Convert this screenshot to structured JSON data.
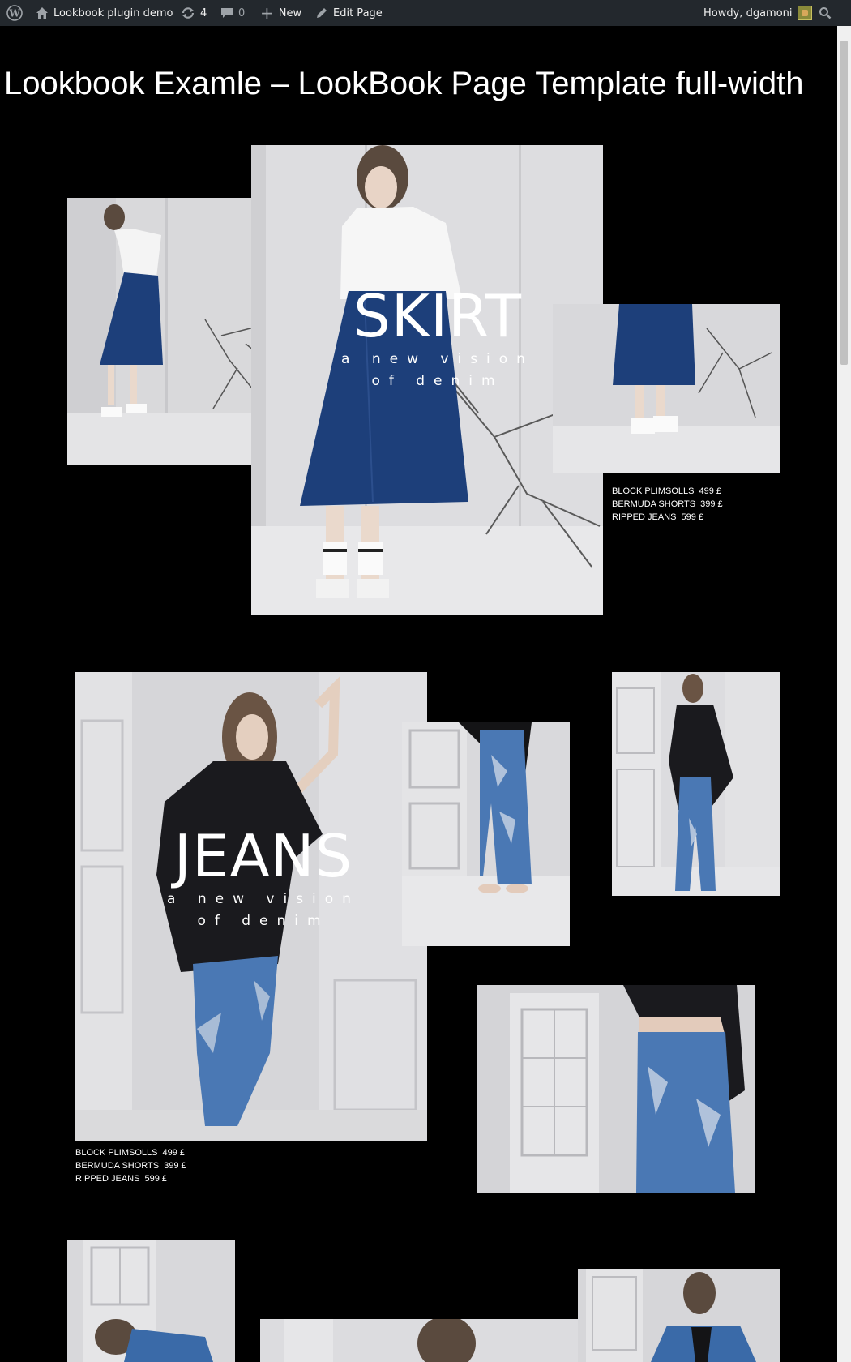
{
  "adminbar": {
    "site_name": "Lookbook plugin demo",
    "updates_count": "4",
    "comments_count": "0",
    "new_label": "New",
    "edit_label": "Edit Page",
    "howdy": "Howdy, dgamoni"
  },
  "page": {
    "title": "Lookbook Examle – LookBook Page Template full-width"
  },
  "sections": [
    {
      "heading": "SKIRT",
      "subheading": "a new vision of denim",
      "products": [
        {
          "name": "BLOCK PLIMSOLLS",
          "price": "499 £"
        },
        {
          "name": "BERMUDA SHORTS",
          "price": "399 £"
        },
        {
          "name": "RIPPED JEANS",
          "price": "599 £"
        }
      ]
    },
    {
      "heading": "JEANS",
      "subheading": "a new vision of denim",
      "products": [
        {
          "name": "BLOCK PLIMSOLLS",
          "price": "499 £"
        },
        {
          "name": "BERMUDA SHORTS",
          "price": "399 £"
        },
        {
          "name": "RIPPED JEANS",
          "price": "599 £"
        }
      ]
    }
  ],
  "colors": {
    "background": "#000000",
    "adminbar": "#23282d",
    "denim_dark": "#1d3f7a",
    "denim_light": "#4a78b4",
    "studio_wall": "#dcdcde"
  }
}
